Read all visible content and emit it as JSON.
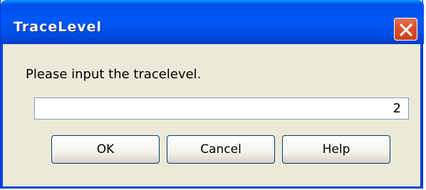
{
  "dialog": {
    "title": "TraceLevel",
    "prompt": "Please input the tracelevel.",
    "input_value": "2",
    "buttons": {
      "ok": "OK",
      "cancel": "Cancel",
      "help": "Help"
    },
    "icons": {
      "close": "close-icon"
    },
    "colors": {
      "title_bar": "#0054e3",
      "close_button": "#d9502a",
      "body": "#ece9d8"
    }
  }
}
